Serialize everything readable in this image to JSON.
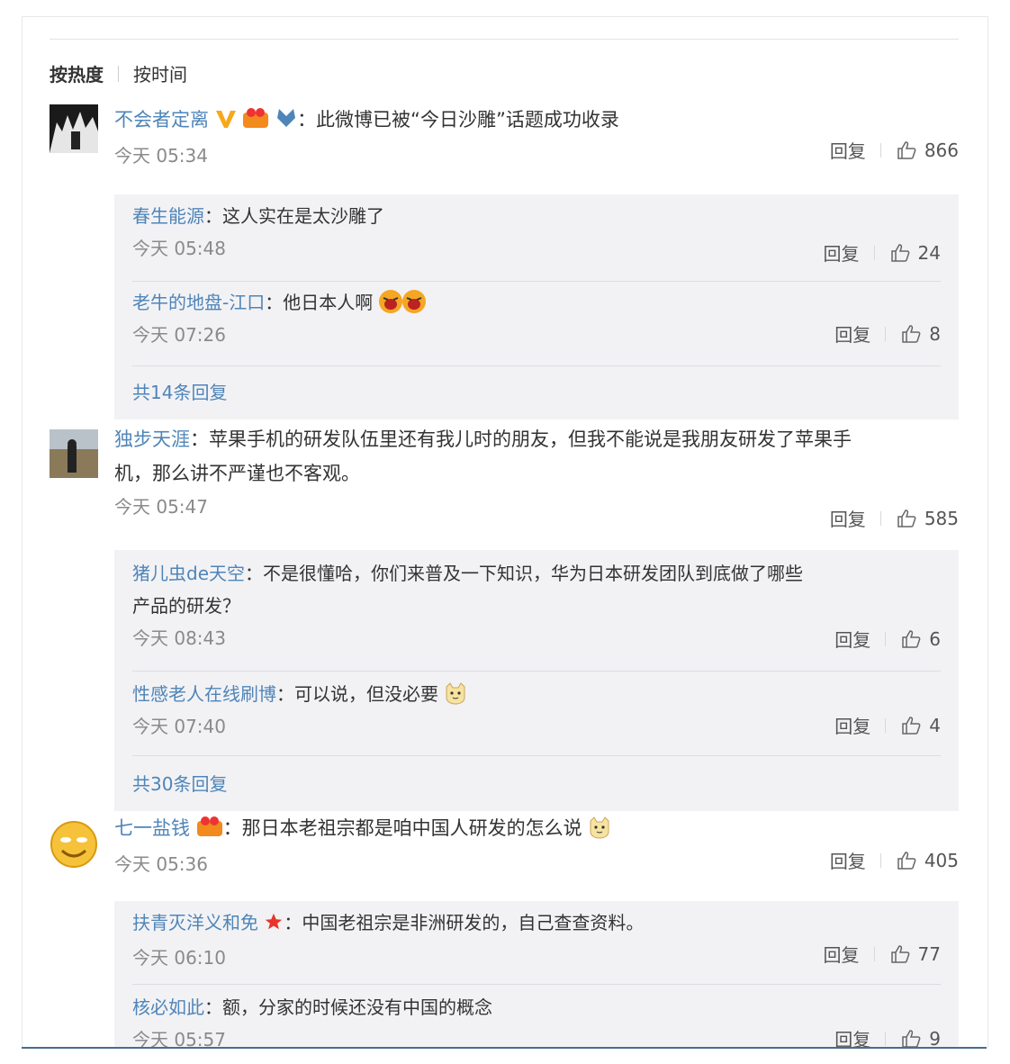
{
  "sort": {
    "hot": "按热度",
    "time": "按时间"
  },
  "actions": {
    "reply": "回复"
  },
  "comments": [
    {
      "user": "不会者定离",
      "content": "：此微博已被“今日沙雕”话题成功收录",
      "time": "今天 05:34",
      "likes": "866",
      "replies": [
        {
          "user": "春生能源",
          "content": "：这人实在是太沙雕了",
          "time": "今天 05:48",
          "likes": "24"
        },
        {
          "user": "老牛的地盘-江口",
          "content": "：他日本人啊",
          "time": "今天 07:26",
          "likes": "8"
        }
      ],
      "more": "共14条回复"
    },
    {
      "user": "独步天涯",
      "content": "：苹果手机的研发队伍里还有我儿时的朋友，但我不能说是我朋友研发了苹果手",
      "content2": "机，那么讲不严谨也不客观。",
      "time": "今天 05:47",
      "likes": "585",
      "replies": [
        {
          "user": "猪儿虫de天空",
          "content": "：不是很懂哈，你们来普及一下知识，华为日本研发团队到底做了哪些",
          "content2": "产品的研发？",
          "time": "今天 08:43",
          "likes": "6"
        },
        {
          "user": "性感老人在线刷博",
          "content": "：可以说，但没必要",
          "time": "今天 07:40",
          "likes": "4"
        }
      ],
      "more": "共30条回复"
    },
    {
      "user": "七一盐钱",
      "content": "：那日本老祖宗都是咱中国人研发的怎么说",
      "time": "今天 05:36",
      "likes": "405",
      "replies": [
        {
          "user": "扶青灭洋义和免",
          "content": "：中国老祖宗是非洲研发的，自己查查资料。",
          "time": "今天 06:10",
          "likes": "77"
        },
        {
          "user": "核必如此",
          "content": "：额，分家的时候还没有中国的概念",
          "time": "今天 05:57",
          "likes": "9"
        }
      ]
    }
  ],
  "colors": {
    "username": "#4f85b8",
    "reply_bg": "#f2f2f5",
    "time": "#8a8a8a"
  },
  "icons": [
    "thumbs-up-icon",
    "vip-v-icon",
    "fan-badge-icon",
    "star-icon",
    "laugh-emoji",
    "cat-emoji"
  ]
}
